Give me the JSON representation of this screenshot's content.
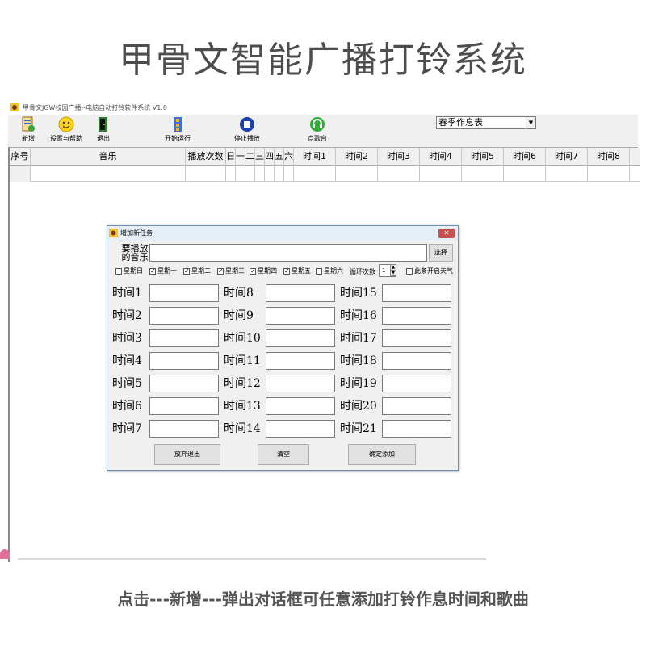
{
  "headline": "甲骨文智能广播打铃系统",
  "caption": "点击---新增---弹出对话框可任意添加打铃作息时间和歌曲",
  "window": {
    "title": "甲骨文JGW校园广播--电脑自动打铃软件系统 V1.0"
  },
  "toolbar": {
    "buttons": [
      {
        "label": "新增",
        "icon": "add-icon"
      },
      {
        "label": "设置与帮助",
        "icon": "smile-icon"
      },
      {
        "label": "退出",
        "icon": "exit-door-icon"
      },
      {
        "label": "开始运行",
        "icon": "run-icon"
      },
      {
        "label": "停止播放",
        "icon": "stop-icon"
      },
      {
        "label": "点歌台",
        "icon": "headset-icon"
      }
    ],
    "schedule": "春季作息表"
  },
  "grid": {
    "columns": [
      "序号",
      "音乐",
      "播放次数",
      "日",
      "一",
      "二",
      "三",
      "四",
      "五",
      "六",
      "时间1",
      "时间2",
      "时间3",
      "时间4",
      "时间5",
      "时间6",
      "时间7",
      "时间8"
    ]
  },
  "dialog": {
    "title": "增加新任务",
    "close": "✕",
    "music_label": "要播放的音乐",
    "music_value": "",
    "choose_label": "选择",
    "days": [
      {
        "label": "星期日",
        "checked": false
      },
      {
        "label": "星期一",
        "checked": true
      },
      {
        "label": "星期二",
        "checked": true
      },
      {
        "label": "星期三",
        "checked": true
      },
      {
        "label": "星期四",
        "checked": true
      },
      {
        "label": "星期五",
        "checked": true
      },
      {
        "label": "星期六",
        "checked": false
      }
    ],
    "loop_label": "循环次数",
    "loop_value": "1",
    "weather_label": "此条开启天气",
    "weather_checked": false,
    "times": [
      "时间1",
      "时间2",
      "时间3",
      "时间4",
      "时间5",
      "时间6",
      "时间7",
      "时间8",
      "时间9",
      "时间10",
      "时间11",
      "时间12",
      "时间13",
      "时间14",
      "时间15",
      "时间16",
      "时间17",
      "时间18",
      "时间19",
      "时间20",
      "时间21"
    ],
    "buttons": {
      "abandon": "放弃退出",
      "clear": "清空",
      "confirm": "确定添加"
    }
  },
  "colors": {
    "headline": "#4d4d4d",
    "close_button": "#c75050",
    "dialog_title_bg": "#e6eef7"
  }
}
